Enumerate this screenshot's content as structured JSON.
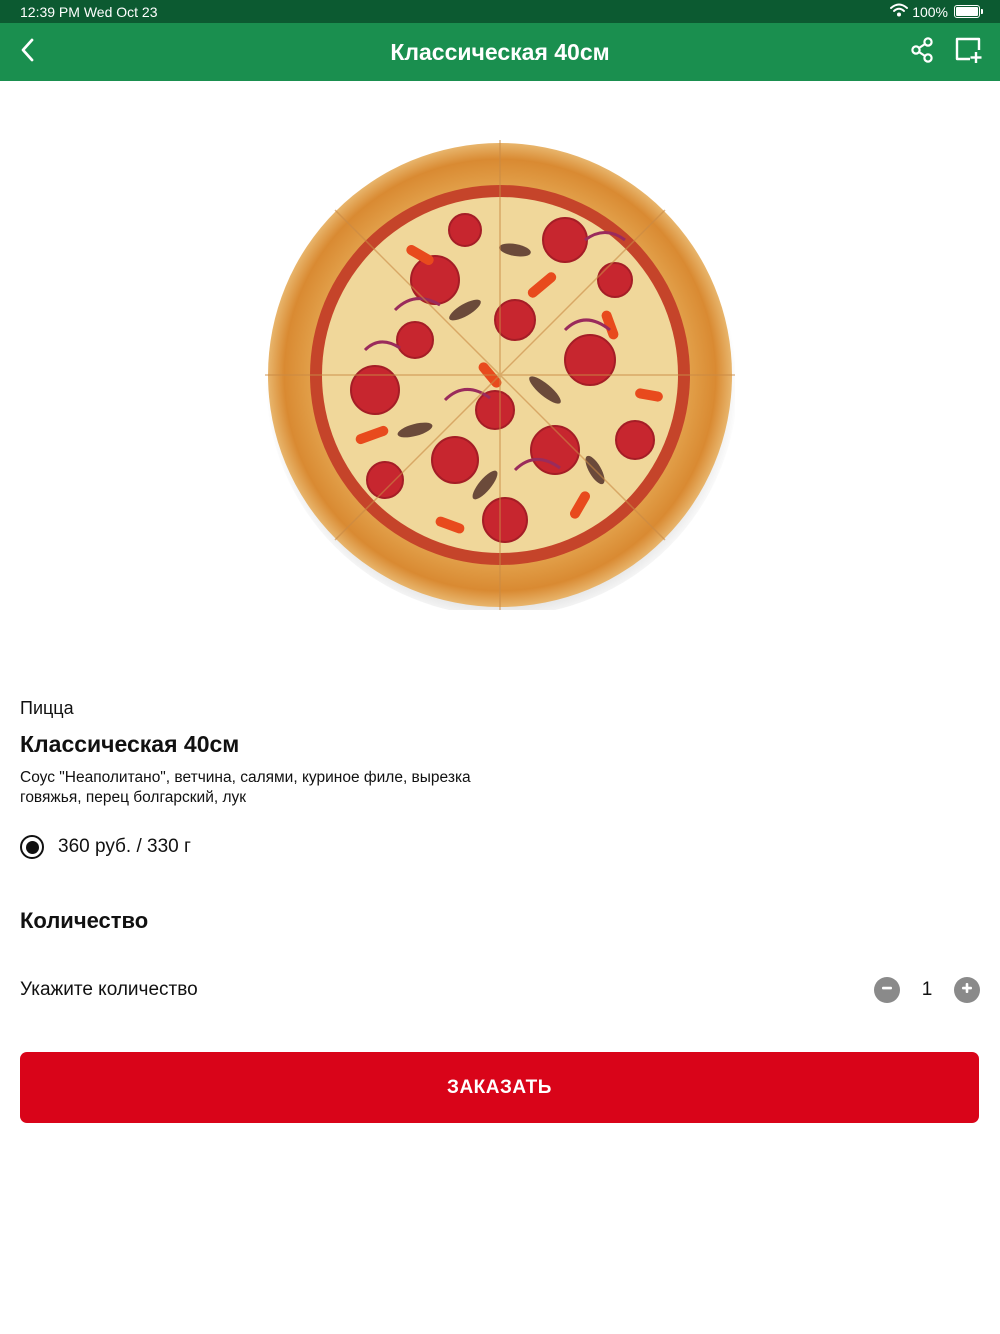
{
  "status_bar": {
    "time": "12:39 PM",
    "date": "Wed Oct 23",
    "battery": "100%",
    "battery_level": 1.0
  },
  "nav": {
    "title": "Классическая 40см",
    "back_icon": "chevron-left-icon",
    "share_icon": "share-icon",
    "add_to_cart_icon": "add-to-cart-icon"
  },
  "product": {
    "category": "Пицца",
    "name": "Классическая 40см",
    "description": "Соус \"Неаполитано\", ветчина, салями, куриное филе, вырезка говяжья, перец болгарский, лук",
    "variant": {
      "label": "360 руб. / 330 г",
      "selected": true
    }
  },
  "quantity": {
    "heading": "Количество",
    "label": "Укажите количество",
    "value": "1"
  },
  "order_button": {
    "label": "ЗАКАЗАТЬ"
  },
  "colors": {
    "status_bar": "#0c5a31",
    "nav_bar": "#1a8f4f",
    "order_button": "#d90419",
    "qty_button": "#8a8a8a"
  }
}
